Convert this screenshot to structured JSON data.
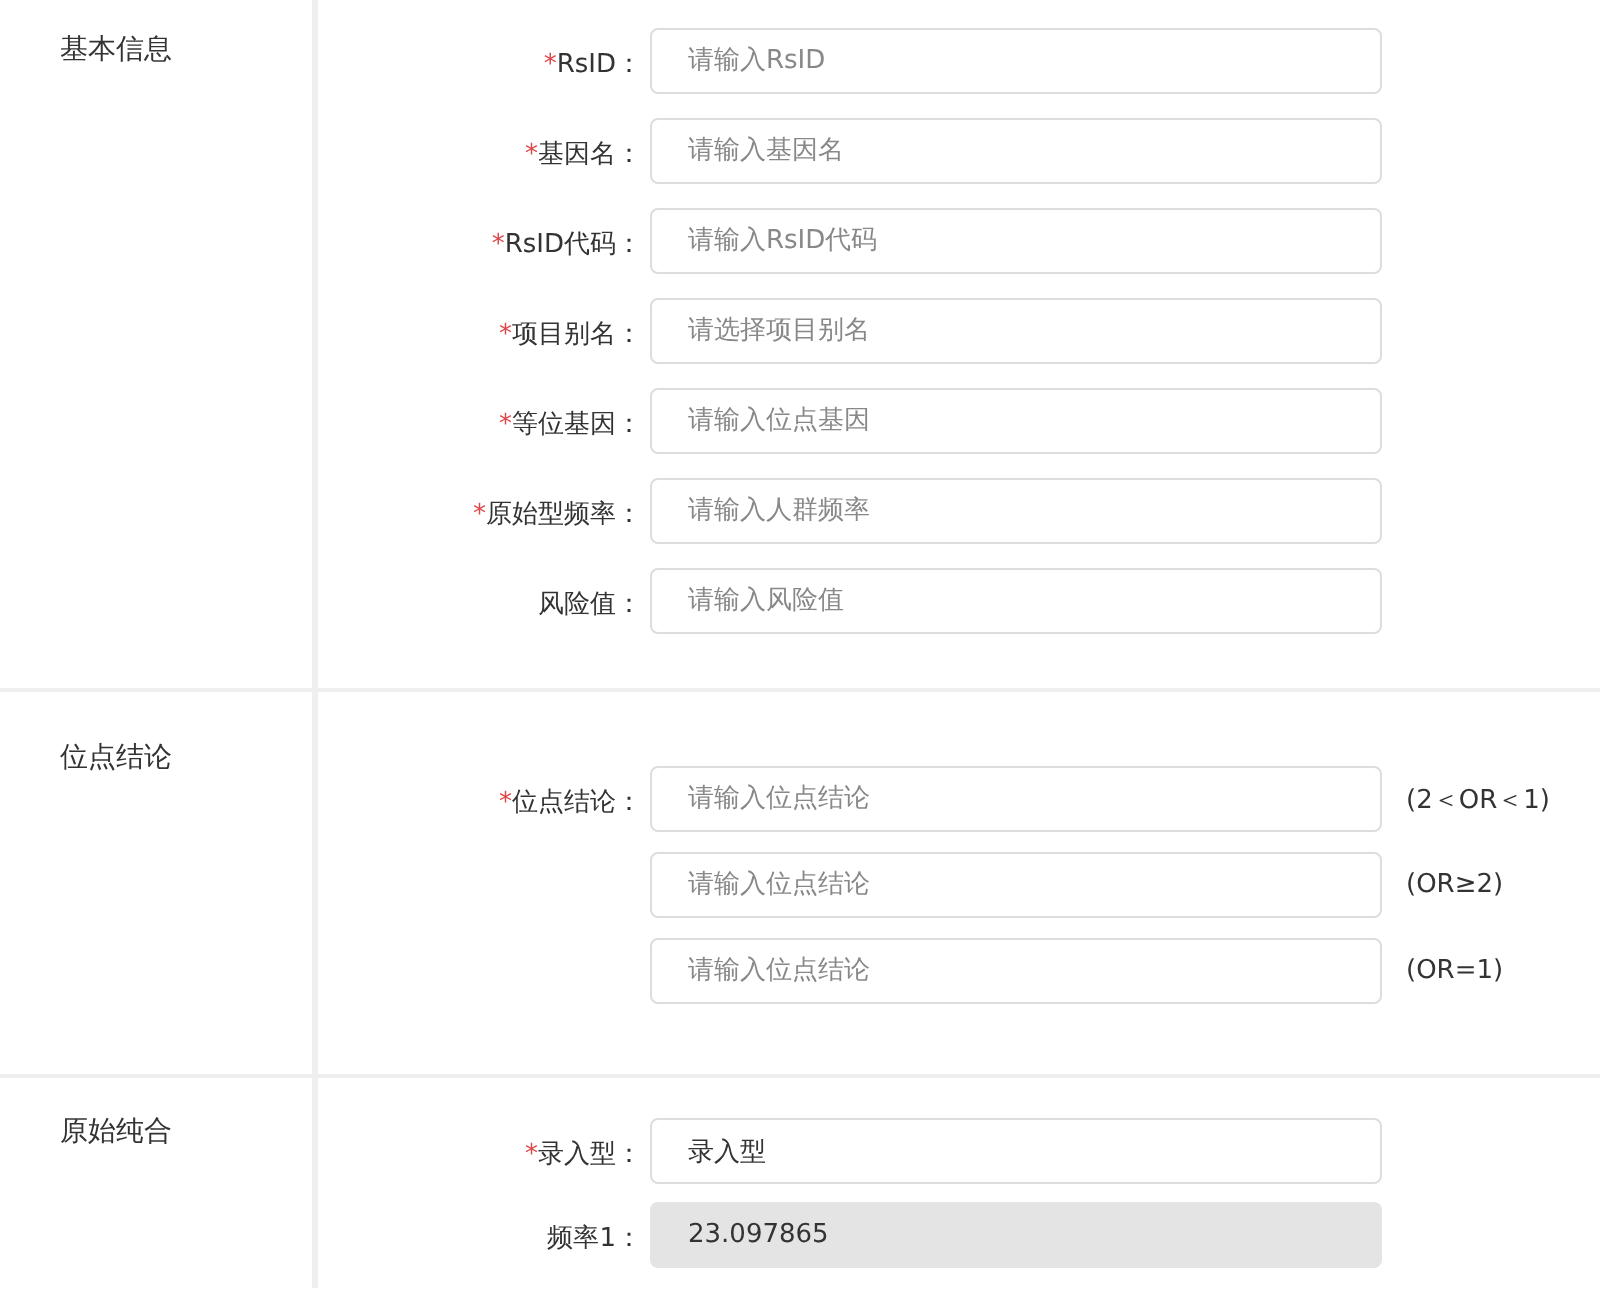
{
  "sections": [
    {
      "title": "基本信息",
      "fields": [
        {
          "required_mark": "*",
          "label": "RsID：",
          "placeholder": "请输入RsID"
        },
        {
          "required_mark": "*",
          "label": "基因名：",
          "placeholder": "请输入基因名"
        },
        {
          "required_mark": "*",
          "label": "RsID代码：",
          "placeholder": "请输入RsID代码"
        },
        {
          "required_mark": "*",
          "label": "项目别名：",
          "placeholder": "请选择项目别名"
        },
        {
          "required_mark": "*",
          "label": "等位基因：",
          "placeholder": "请输入位点基因"
        },
        {
          "required_mark": "*",
          "label": "原始型频率：",
          "placeholder": "请输入人群频率"
        },
        {
          "label": "风险值：",
          "placeholder": "请输入风险值"
        }
      ]
    },
    {
      "title": "位点结论",
      "fields": [
        {
          "required_mark": "*",
          "label": "位点结论：",
          "placeholder": "请输入位点结论",
          "note": "(2＜OR＜1)"
        },
        {
          "placeholder": "请输入位点结论",
          "note": "(OR≥2)"
        },
        {
          "placeholder": "请输入位点结论",
          "note": "(OR=1)"
        }
      ]
    },
    {
      "title": "原始纯合",
      "fields": [
        {
          "required_mark": "*",
          "label": "录入型：",
          "value": "录入型",
          "disabled": false
        },
        {
          "label": "频率1：",
          "value": "23.097865",
          "disabled": true
        }
      ]
    }
  ]
}
